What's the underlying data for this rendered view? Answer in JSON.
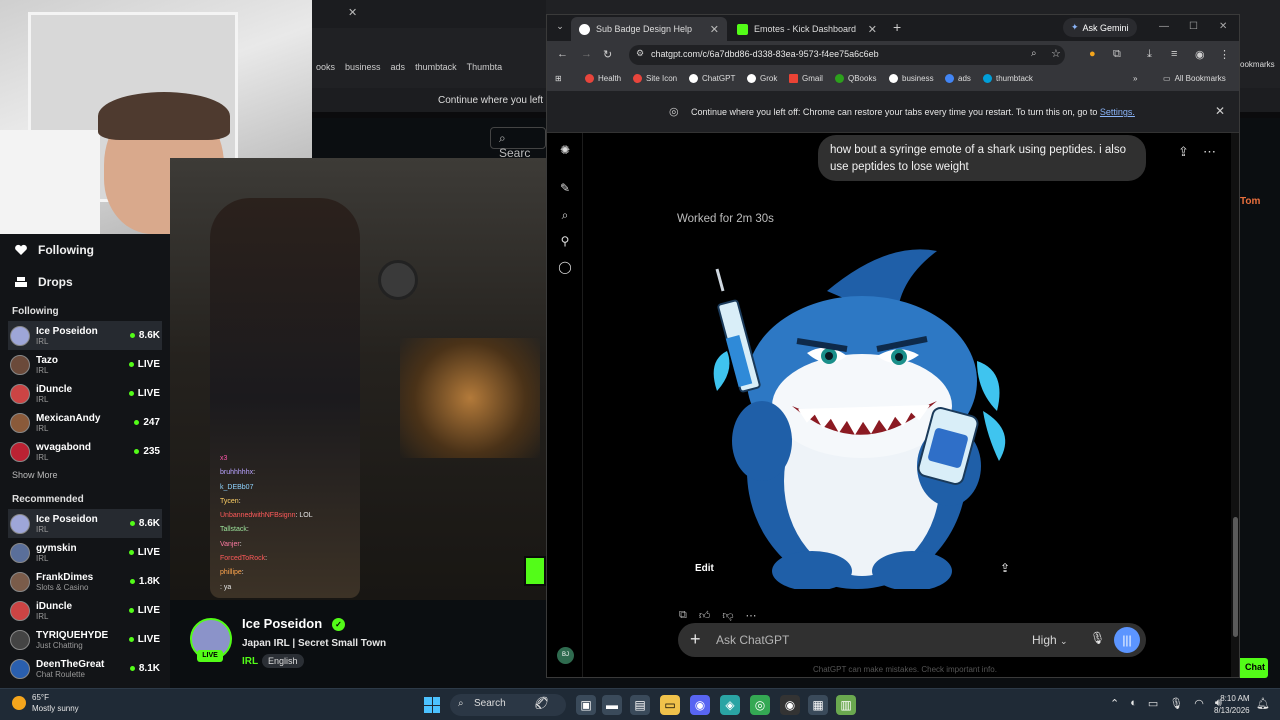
{
  "background_page": {
    "bookmarks": [
      "ooks",
      "business",
      "ads",
      "thumbtack",
      "Thumbta"
    ],
    "continue_text": "Continue where you left off",
    "search_placeholder": "Searc"
  },
  "sidebar": {
    "nav": [
      {
        "label": "Following",
        "icon": "heart-icon"
      },
      {
        "label": "Drops",
        "icon": "drops-icon"
      }
    ],
    "following_heading": "Following",
    "following": [
      {
        "name": "Ice Poseidon",
        "sub": "IRL",
        "stat": "8.6K",
        "active": true
      },
      {
        "name": "Tazo",
        "sub": "IRL",
        "stat": "LIVE"
      },
      {
        "name": "iDuncle",
        "sub": "IRL",
        "stat": "LIVE"
      },
      {
        "name": "MexicanAndy",
        "sub": "IRL",
        "stat": "247"
      },
      {
        "name": "wvagabond",
        "sub": "IRL",
        "stat": "235"
      }
    ],
    "show_more": "Show More",
    "recommended_heading": "Recommended",
    "recommended": [
      {
        "name": "Ice Poseidon",
        "sub": "IRL",
        "stat": "8.6K",
        "active": true
      },
      {
        "name": "gymskin",
        "sub": "IRL",
        "stat": "LIVE"
      },
      {
        "name": "FrankDimes",
        "sub": "Slots & Casino",
        "stat": "1.8K"
      },
      {
        "name": "iDuncle",
        "sub": "IRL",
        "stat": "LIVE"
      },
      {
        "name": "TYRIQUEHYDE",
        "sub": "Just Chatting",
        "stat": "LIVE"
      },
      {
        "name": "DeenTheGreat",
        "sub": "Chat Roulette",
        "stat": "8.1K"
      }
    ]
  },
  "video_chat": [
    {
      "user": "x3",
      "msg": ""
    },
    {
      "user": "bruhhhhhx",
      "msg": ""
    },
    {
      "user": "k_DEBb07",
      "msg": ""
    },
    {
      "user": "Tycen",
      "msg": ""
    },
    {
      "user": "UnbannedwithNFBsignn",
      "msg": "LOL"
    },
    {
      "user": "Tallstack",
      "msg": ""
    },
    {
      "user": "Vanjer",
      "msg": ""
    },
    {
      "user": "ForcedToRock",
      "msg": ""
    },
    {
      "user": "phillipe",
      "msg": ""
    },
    {
      "user": "",
      "msg": "ya"
    }
  ],
  "stream": {
    "streamer": "Ice Poseidon",
    "live_badge": "LIVE",
    "title": "Japan IRL | Secret Small Town",
    "category": "IRL",
    "tag": "English"
  },
  "right_strip": {
    "name": "Tom",
    "chat_button": "Chat",
    "bookmarks_label": "ookmarks"
  },
  "browser": {
    "tabs": [
      {
        "title": "Sub Badge Design Help",
        "active": true
      },
      {
        "title": "Emotes - Kick Dashboard",
        "active": false
      }
    ],
    "ask_gemini": "Ask Gemini",
    "url": "chatgpt.com/c/6a7dbd86-d338-83ea-9573-f4ee75a6c6eb",
    "bookmarks": [
      {
        "label": "Health",
        "color": "#e8453c"
      },
      {
        "label": "Site Icon",
        "color": "#e8453c"
      },
      {
        "label": "ChatGPT",
        "color": "#ffffff"
      },
      {
        "label": "Grok",
        "color": "#ffffff"
      },
      {
        "label": "Gmail",
        "color": "#ea4335"
      },
      {
        "label": "QBooks",
        "color": "#2ca01c"
      },
      {
        "label": "business",
        "color": "#ffffff"
      },
      {
        "label": "ads",
        "color": "#4285f4"
      },
      {
        "label": "thumbtack",
        "color": "#009fd9"
      }
    ],
    "all_bookmarks": "All Bookmarks",
    "continue": {
      "text": "Continue where you left off: Chrome can restore your tabs every time you restart. To turn this on, go to",
      "link": "Settings."
    }
  },
  "chatgpt": {
    "user_message": "how bout a syringe emote of a shark using peptides. i also use peptides to lose weight",
    "worked_for": "Worked for 2m 30s",
    "edit_label": "Edit",
    "composer_placeholder": "Ask ChatGPT",
    "model_setting": "High",
    "disclaimer": "ChatGPT can make mistakes. Check important info.",
    "avatar_initials": "BJ"
  },
  "taskbar": {
    "temperature": "65°F",
    "weather": "Mostly sunny",
    "search": "Search",
    "time": "8:10 AM",
    "date": "8/13/2026"
  }
}
